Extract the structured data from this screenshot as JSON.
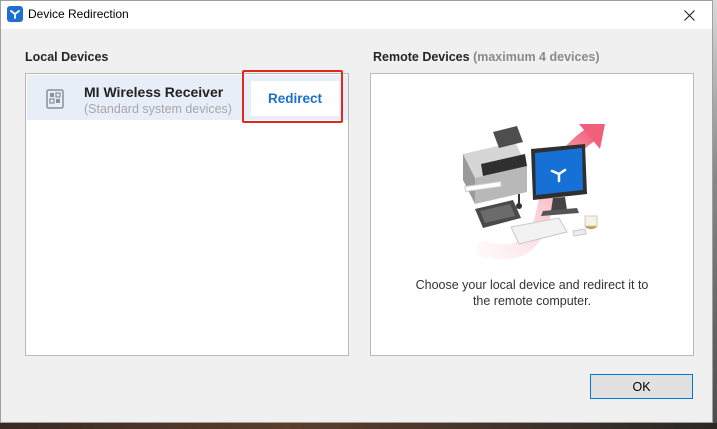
{
  "window": {
    "title": "Device Redirection"
  },
  "local": {
    "heading": "Local Devices",
    "devices": [
      {
        "name": "MI Wireless Receiver",
        "category": "(Standard system devices)",
        "action": "Redirect",
        "icon": "usb-receiver-icon"
      }
    ]
  },
  "remote": {
    "heading": "Remote Devices",
    "heading_note": "(maximum 4 devices)",
    "message_line1": "Choose your local device and redirect it to",
    "message_line2": "the remote computer."
  },
  "footer": {
    "ok_label": "OK"
  },
  "colors": {
    "accent": "#1a6fc7",
    "highlight": "#e0281f",
    "selected_row": "#e8eef8"
  }
}
